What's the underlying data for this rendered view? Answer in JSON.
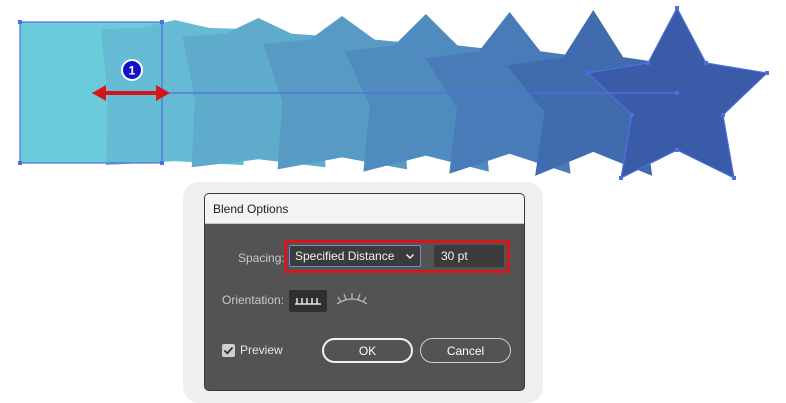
{
  "dialog": {
    "title": "Blend Options",
    "spacing_label": "Spacing:",
    "spacing_select": {
      "selected": "Specified Distance",
      "icon": "chevron-down-icon"
    },
    "spacing_value": "30 pt",
    "orientation_label": "Orientation:",
    "orientation_options": [
      {
        "icon": "align-to-page-icon",
        "selected": true
      },
      {
        "icon": "align-to-path-icon",
        "selected": false
      }
    ],
    "preview_label": "Preview",
    "preview_checked": true,
    "ok_label": "OK",
    "cancel_label": "Cancel"
  },
  "canvas": {
    "callout_number": "1",
    "blend_start_color": "#6ccbdb",
    "blend_end_color": "#3a5ba8",
    "annotation_color": "#d7161c",
    "selection_color": "#4f6fe0"
  }
}
